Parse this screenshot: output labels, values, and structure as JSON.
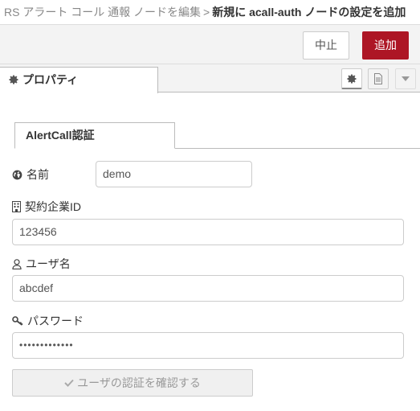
{
  "titlebar": {
    "breadcrumb_prev": "RS アラート コール 通報 ノードを編集",
    "separator": ">",
    "current": "新規に acall-auth ノードの設定を追加"
  },
  "toolbar": {
    "cancel_label": "中止",
    "add_label": "追加"
  },
  "tabs": {
    "properties_label": "プロパティ"
  },
  "config": {
    "tab_label": "AlertCall認証",
    "name_label": "名前",
    "name_value": "demo",
    "contract_label": "契約企業ID",
    "contract_value": "123456",
    "user_label": "ユーザ名",
    "user_value": "abcdef",
    "password_label": "パスワード",
    "password_value": "•••••••••••••",
    "verify_label": "ユーザの認証を確認する"
  },
  "colors": {
    "accent_red": "#ad1625",
    "toolbar_bg": "#f3f3f3"
  }
}
